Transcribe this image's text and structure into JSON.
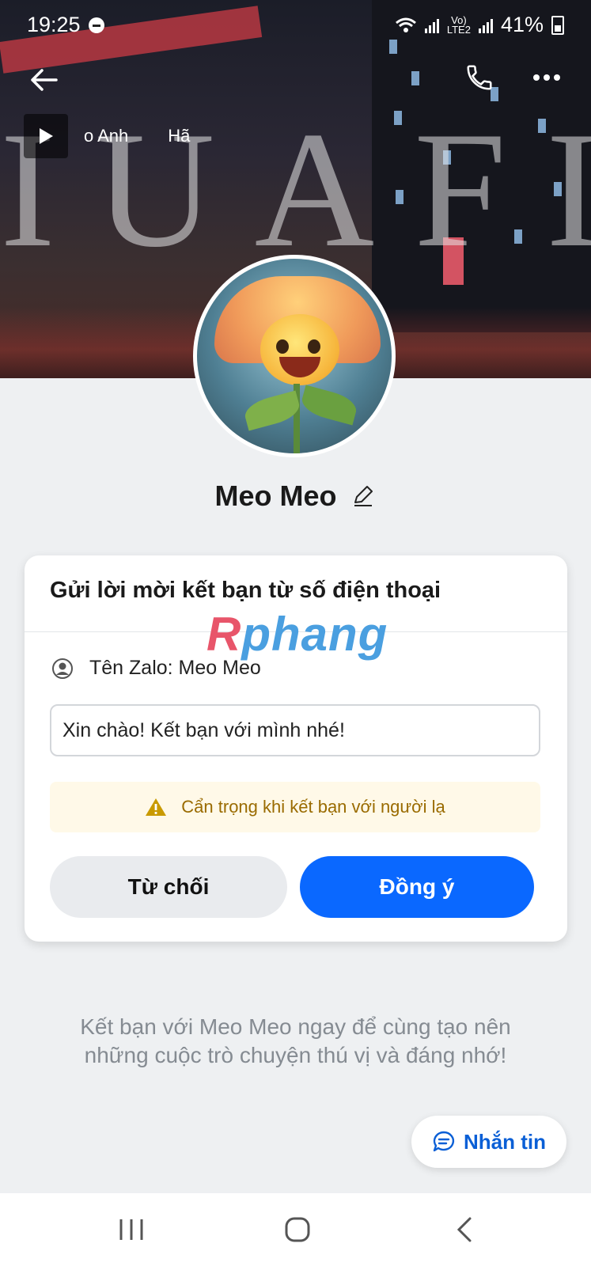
{
  "status_bar": {
    "time": "19:25",
    "network_label_1": "Vo)",
    "network_label_2": "LTE2",
    "battery": "41%"
  },
  "header": {
    "music_tracks": [
      "o Anh",
      "Hã"
    ]
  },
  "profile": {
    "name": "Meo Meo"
  },
  "card": {
    "title": "Gửi lời mời kết bạn từ số điện thoại",
    "watermark": "Rphang",
    "zalo_name": "Tên Zalo: Meo Meo",
    "message": "Xin chào! Kết bạn với mình nhé!",
    "warning": "Cẩn trọng khi kết bạn với người lạ",
    "decline_label": "Từ chối",
    "accept_label": "Đồng ý"
  },
  "footer": {
    "text_line1": "Kết bạn với Meo Meo ngay để cùng tạo nên",
    "text_line2": "những cuộc trò chuyện thú vị và đáng nhớ!"
  },
  "chat_button": {
    "label": "Nhắn tin"
  },
  "colors": {
    "accent": "#0a68ff",
    "warning_bg": "#fff9e8",
    "warning_text": "#9a6b00"
  }
}
